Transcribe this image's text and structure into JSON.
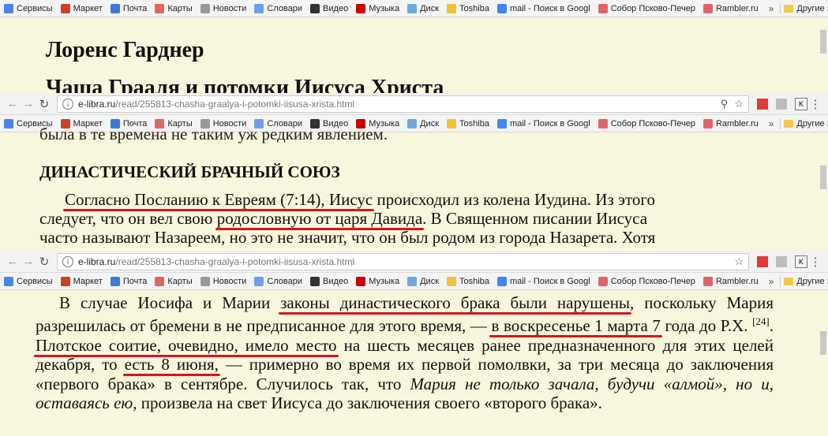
{
  "bookmarks": [
    {
      "label": "Сервисы",
      "icon": "apps-grid-icon",
      "color": "#4a86e8"
    },
    {
      "label": "Маркет",
      "icon": "market-icon",
      "color": "#cc4125"
    },
    {
      "label": "Почта",
      "icon": "mail-icon",
      "color": "#3c78d8"
    },
    {
      "label": "Карты",
      "icon": "map-pin-icon",
      "color": "#e06666"
    },
    {
      "label": "Новости",
      "icon": "news-icon",
      "color": "#999999"
    },
    {
      "label": "Словари",
      "icon": "dictionary-icon",
      "color": "#6d9eeb"
    },
    {
      "label": "Видео",
      "icon": "video-play-icon",
      "color": "#333333"
    },
    {
      "label": "Музыка",
      "icon": "music-note-icon",
      "color": "#cc0000"
    },
    {
      "label": "Диск",
      "icon": "disk-icon",
      "color": "#6fa8dc"
    },
    {
      "label": "Toshiba",
      "icon": "folder-icon",
      "color": "#f1c232"
    },
    {
      "label": "mail - Поиск в Googl",
      "icon": "google-icon",
      "color": "#4285f4"
    },
    {
      "label": "Собор Псково-Печер",
      "icon": "yandex-icon",
      "color": "#e06666"
    },
    {
      "label": "Rambler.ru",
      "icon": "yandex-icon",
      "color": "#e06666"
    }
  ],
  "bookmarks_more": "»",
  "other_bookmarks": "Другие закладки",
  "address": {
    "domain": "e-libra.ru",
    "path": "/read/255813-chasha-graalya-i-potomki-iisusa-xrista.html"
  },
  "panel1": {
    "author": "Лоренс Гарднер",
    "title": "Чаша Грааля и потомки Иисуса Христа"
  },
  "panel2": {
    "cut_line": "была в те времена не таким уж редким явлением.",
    "heading": "ДИНАСТИЧЕСКИЙ БРАЧНЫЙ СОЮЗ",
    "l1a": "Согласно Посланию к Евреям (7:14), Иисус",
    "l1b": " происходил из колена Иудина. Из этого",
    "l2a": "следует, что он вел свою ",
    "l2b": "родословную от царя Давида",
    "l2c": ". В Священном писании Иисуса",
    "l3": "часто называют Назареем, но это не значит, что он был родом из города Назарета. Хотя"
  },
  "panel3": {
    "s1": "В случае Иосифа и Марии ",
    "s2": "законы династического брака были нарушены",
    "s3": ", поскольку Мария разрешилась от бремени в не предписанное для этого время, — ",
    "s4": "в воскресенье 1 марта 7",
    "s5": " года до Р.Х. ",
    "s6": "[24]",
    "s7": ". ",
    "s8": "Плотское соитие, очевидно, имело место",
    "s9": " на шесть месяцев ранее предназначенного для этих целей декабря, то ",
    "s10": "есть 8 июня,",
    "s11": " — примерно во время их первой помолвки, за три месяца до заключения «первого брака» в сентябре. Случилось так, что ",
    "s12": "Мария не только зачала, будучи «алмой», но и, оставаясь ею,",
    "s13": " произвела на свет Иисуса до заключения своего «второго брака»."
  }
}
